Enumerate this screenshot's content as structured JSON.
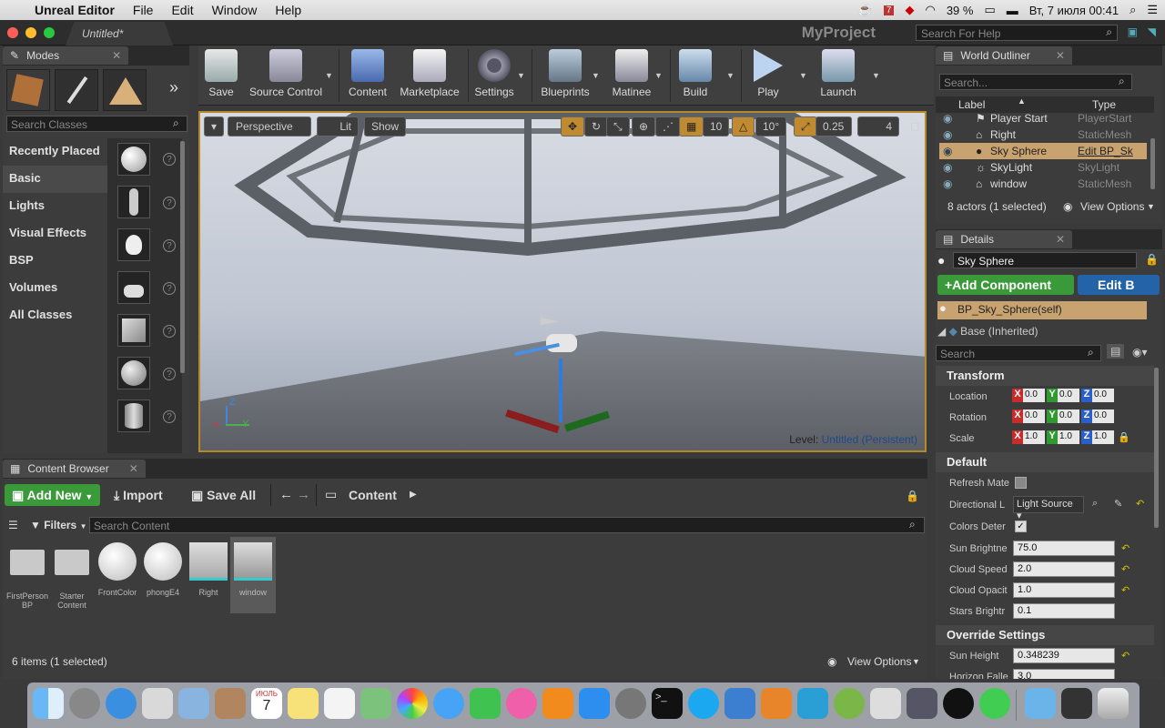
{
  "menubar": {
    "app": "Unreal Editor",
    "items": [
      "File",
      "Edit",
      "Window",
      "Help"
    ],
    "calendar_day": "7",
    "battery": "39 %",
    "datetime": "Вт, 7 июля  00:41"
  },
  "window": {
    "tab_title": "Untitled*",
    "project": "MyProject",
    "search_help_placeholder": "Search For Help"
  },
  "modes": {
    "tab": "Modes",
    "search_placeholder": "Search Classes",
    "categories": [
      "Recently Placed",
      "Basic",
      "Lights",
      "Visual Effects",
      "BSP",
      "Volumes",
      "All Classes"
    ],
    "selected": "Basic"
  },
  "toolbar": {
    "buttons": [
      "Save",
      "Source Control",
      "Content",
      "Marketplace",
      "Settings",
      "Blueprints",
      "Matinee",
      "Build",
      "Play",
      "Launch"
    ]
  },
  "viewport": {
    "perspective": "Perspective",
    "lit": "Lit",
    "show": "Show",
    "grid_snap": "10",
    "rot_snap": "10°",
    "scale_snap": "0.25",
    "camera_speed": "4",
    "level_label": "Level:",
    "level_name": "Untitled (Persistent)",
    "axis_z": "Z",
    "axis_y": "Y"
  },
  "outliner": {
    "tab": "World Outliner",
    "search_placeholder": "Search...",
    "col_label": "Label",
    "col_type": "Type",
    "rows": [
      {
        "label": "Player Start",
        "type": "PlayerStart"
      },
      {
        "label": "Right",
        "type": "StaticMesh"
      },
      {
        "label": "Sky Sphere",
        "type": "Edit BP_Sk"
      },
      {
        "label": "SkyLight",
        "type": "SkyLight"
      },
      {
        "label": "window",
        "type": "StaticMesh"
      }
    ],
    "summary": "8 actors (1 selected)",
    "view_options": "View Options"
  },
  "details": {
    "tab": "Details",
    "name": "Sky Sphere",
    "add_component": "+Add Component",
    "edit_bp": "Edit B",
    "self_item": "BP_Sky_Sphere(self)",
    "base_item": "Base (Inherited)",
    "search_placeholder": "Search",
    "transform": "Transform",
    "location": {
      "label": "Location",
      "x": "0.0",
      "y": "0.0",
      "z": "0.0"
    },
    "rotation": {
      "label": "Rotation",
      "x": "0.0",
      "y": "0.0",
      "z": "0.0"
    },
    "scale": {
      "label": "Scale",
      "x": "1.0",
      "y": "1.0",
      "z": "1.0"
    },
    "default": "Default",
    "refresh_material": "Refresh Mate",
    "directional_light": "Directional L",
    "light_source": "Light Source",
    "colors_determined": "Colors Deter",
    "sun_brightness": {
      "label": "Sun Brightne",
      "value": "75.0"
    },
    "cloud_speed": {
      "label": "Cloud Speed",
      "value": "2.0"
    },
    "cloud_opacity": {
      "label": "Cloud Opacit",
      "value": "1.0"
    },
    "stars_brightness": {
      "label": "Stars Brightr",
      "value": "0.1"
    },
    "override": "Override Settings",
    "sun_height": {
      "label": "Sun Height",
      "value": "0.348239"
    },
    "horizon_falloff": {
      "label": "Horizon Falle",
      "value": "3.0"
    }
  },
  "content_browser": {
    "tab": "Content Browser",
    "add_new": "Add New",
    "import": "Import",
    "save_all": "Save All",
    "path": "Content",
    "filters": "Filters",
    "search_placeholder": "Search Content",
    "assets": [
      "FirstPerson BP",
      "Starter Content",
      "FrontColor",
      "phongE4",
      "Right",
      "window"
    ],
    "status": "6 items (1 selected)",
    "view_options": "View Options"
  },
  "dock": {
    "apps": [
      "Finder",
      "Launchpad",
      "Safari",
      "Preview",
      "Mail",
      "Contacts",
      "Calendar",
      "Notes",
      "Reminders",
      "Maps",
      "Photos",
      "Messages",
      "FaceTime",
      "iTunes",
      "iBooks",
      "App Store",
      "System Preferences",
      "Terminal",
      "Skype",
      "Xcode",
      "Sublime Text",
      "AppCode",
      "Android Studio",
      "Unity",
      "Remote Desktop",
      "Unreal Engine",
      "Qt Creator",
      "Downloads",
      "Monitor",
      "Trash"
    ],
    "calendar_month": "ИЮЛЬ",
    "calendar_day": "7"
  },
  "colors": {
    "accent_green": "#3a9a3a",
    "accent_blue": "#2563a8",
    "selection": "#c8a370",
    "viewport_border": "#b38a2a"
  }
}
